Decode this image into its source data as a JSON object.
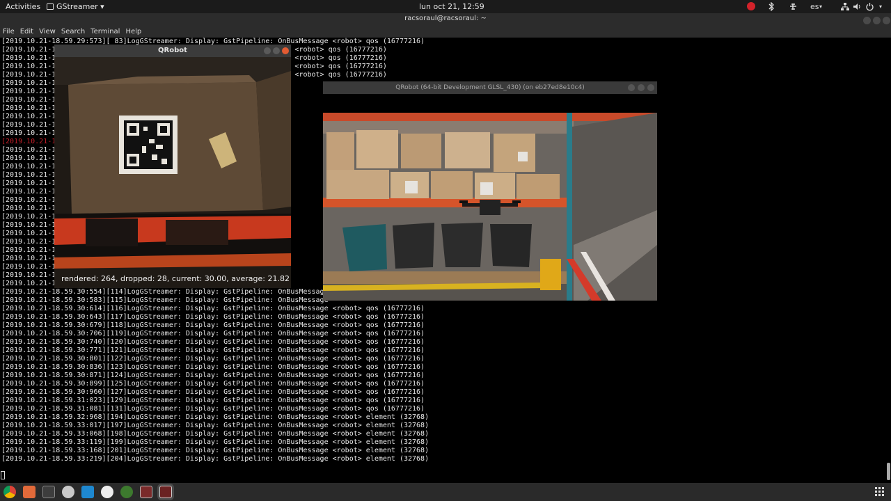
{
  "topbar": {
    "activities": "Activities",
    "app_menu": "GStreamer ▾",
    "clock": "lun oct 21, 12:59",
    "keyboard_layout": "es",
    "tray_icons": [
      "record-icon",
      "bluetooth-icon",
      "network-app-icon",
      "keyboard-icon",
      "network-icon",
      "volume-icon",
      "power-icon"
    ]
  },
  "terminal": {
    "title": "racsoraul@racsoraul: ~",
    "menu": [
      "File",
      "Edit",
      "View",
      "Search",
      "Terminal",
      "Help"
    ],
    "lines": [
      "[2019.10.21-18.59.29:573][ 83]LogGStreamer: Display: GstPipeline: OnBusMessage <robot> qos (16777216)",
      "[2019.10.21-1                                                sMessage <robot> qos (16777216)",
      "[2019.10.21-1                                                sMessage <robot> qos (16777216)",
      "[2019.10.21-1                                                sMessage <robot> qos (16777216)",
      "[2019.10.21-1                                                sMessage <robot> qos (16777216)",
      "[2019.10.21-1                                                sMessage",
      "[2019.10.21-1                                                sMessage",
      "[2019.10.21-1                                                sMessage",
      "[2019.10.21-1                                                sMessage",
      "[2019.10.21-1                                                sMessage",
      "[2019.10.21-1                                                sMessage",
      "[2019.10.21-1                                                sMessage",
      "[2019.10.21-1                                                RNING",
      "[2019.10.21-1                                                sMessage",
      "[2019.10.21-1                                                sMessage",
      "[2019.10.21-1                                                sMessage",
      "[2019.10.21-1                                                sMessage",
      "[2019.10.21-1                                                sMessage",
      "[2019.10.21-1                                                sMessage",
      "[2019.10.21-1                                                sMessage",
      "[2019.10.21-1                                                sMessage",
      "[2019.10.21-1                                                sMessage",
      "[2019.10.21-1                                                sMessage",
      "[2019.10.21-1                                                sMessage",
      "[2019.10.21-1                                                sMessage",
      "[2019.10.21-1                                                sMessage",
      "[2019.10.21-1                                                sMessage",
      "[2019.10.21-1                                                sMessage",
      "[2019.10.21-1                                                sMessage",
      "[2019.10.21-1                                                sMessage",
      "[2019.10.21-18.59.30:554][114]LogGStreamer: Display: GstPipeline: OnBusMessage",
      "[2019.10.21-18.59.30:583][115]LogGStreamer: Display: GstPipeline: OnBusMessage",
      "[2019.10.21-18.59.30:614][116]LogGStreamer: Display: GstPipeline: OnBusMessage <robot> qos (16777216)",
      "[2019.10.21-18.59.30:643][117]LogGStreamer: Display: GstPipeline: OnBusMessage <robot> qos (16777216)",
      "[2019.10.21-18.59.30:679][118]LogGStreamer: Display: GstPipeline: OnBusMessage <robot> qos (16777216)",
      "[2019.10.21-18.59.30:706][119]LogGStreamer: Display: GstPipeline: OnBusMessage <robot> qos (16777216)",
      "[2019.10.21-18.59.30:740][120]LogGStreamer: Display: GstPipeline: OnBusMessage <robot> qos (16777216)",
      "[2019.10.21-18.59.30:771][121]LogGStreamer: Display: GstPipeline: OnBusMessage <robot> qos (16777216)",
      "[2019.10.21-18.59.30:801][122]LogGStreamer: Display: GstPipeline: OnBusMessage <robot> qos (16777216)",
      "[2019.10.21-18.59.30:836][123]LogGStreamer: Display: GstPipeline: OnBusMessage <robot> qos (16777216)",
      "[2019.10.21-18.59.30:871][124]LogGStreamer: Display: GstPipeline: OnBusMessage <robot> qos (16777216)",
      "[2019.10.21-18.59.30:899][125]LogGStreamer: Display: GstPipeline: OnBusMessage <robot> qos (16777216)",
      "[2019.10.21-18.59.30:960][127]LogGStreamer: Display: GstPipeline: OnBusMessage <robot> qos (16777216)",
      "[2019.10.21-18.59.31:023][129]LogGStreamer: Display: GstPipeline: OnBusMessage <robot> qos (16777216)",
      "[2019.10.21-18.59.31:081][131]LogGStreamer: Display: GstPipeline: OnBusMessage <robot> qos (16777216)",
      "[2019.10.21-18.59.32:968][194]LogGStreamer: Display: GstPipeline: OnBusMessage <robot> element (32768)",
      "[2019.10.21-18.59.33:017][197]LogGStreamer: Display: GstPipeline: OnBusMessage <robot> element (32768)",
      "[2019.10.21-18.59.33:068][198]LogGStreamer: Display: GstPipeline: OnBusMessage <robot> element (32768)",
      "[2019.10.21-18.59.33:119][199]LogGStreamer: Display: GstPipeline: OnBusMessage <robot> element (32768)",
      "[2019.10.21-18.59.33:168][201]LogGStreamer: Display: GstPipeline: OnBusMessage <robot> element (32768)",
      "[2019.10.21-18.59.33:219][204]LogGStreamer: Display: GstPipeline: OnBusMessage <robot> element (32768)"
    ]
  },
  "qrobot_window": {
    "title": "QRobot",
    "stats": "rendered: 264, dropped: 28, current: 30.00, average: 21.82"
  },
  "qrobot3d_window": {
    "title": "QRobot (64-bit Development GLSL_430)  (on eb27ed8e10c4)"
  },
  "dock": {
    "apps": [
      "chrome-icon",
      "files-icon",
      "terminal-icon",
      "gitkraken-icon",
      "vscode-icon",
      "unreal-engine-icon",
      "nvidia-icon",
      "window-icon",
      "active-window-icon"
    ]
  },
  "colors": {
    "topbar_bg": "#1b1b1b",
    "terminal_bg": "#000000",
    "terminal_text": "#e8e8e8",
    "warning_text": "#c8202a",
    "close_button": "#e25b32"
  }
}
